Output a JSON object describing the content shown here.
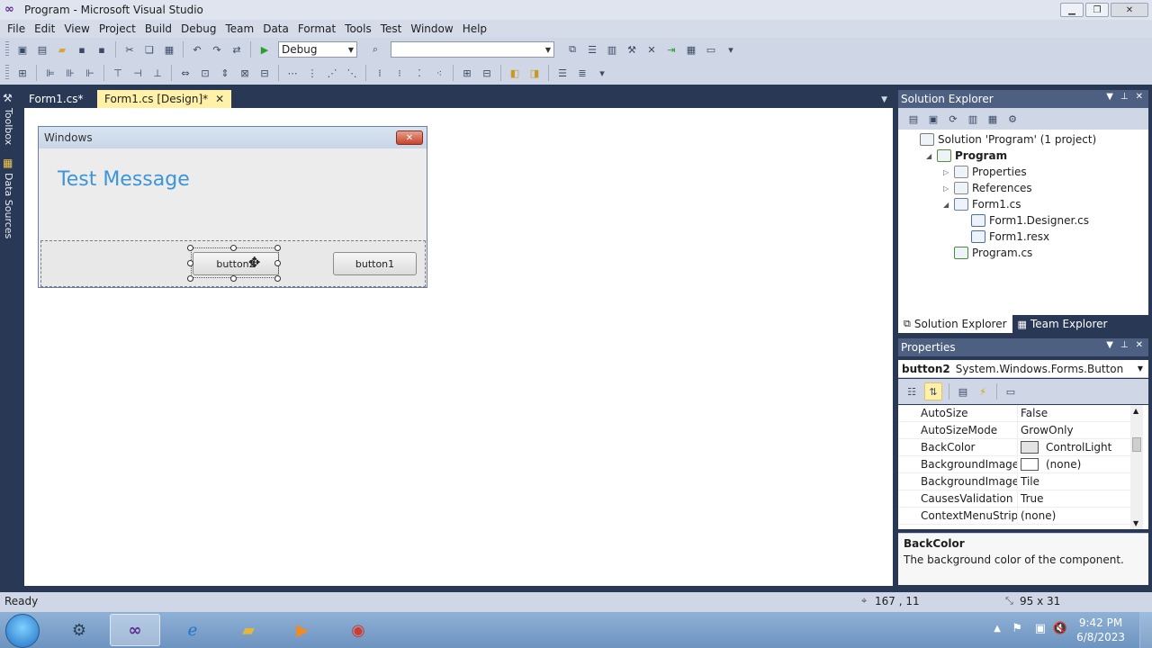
{
  "window": {
    "title": "Program - Microsoft Visual Studio"
  },
  "menu": [
    "File",
    "Edit",
    "View",
    "Project",
    "Build",
    "Debug",
    "Team",
    "Data",
    "Format",
    "Tools",
    "Test",
    "Window",
    "Help"
  ],
  "toolbar": {
    "config": "Debug",
    "platform": ""
  },
  "left_rail": {
    "toolbox": "Toolbox",
    "datasources": "Data Sources"
  },
  "tabs": [
    {
      "label": "Form1.cs*",
      "active": false
    },
    {
      "label": "Form1.cs [Design]*",
      "active": true
    }
  ],
  "designer": {
    "form_title": "Windows",
    "label": "Test Message",
    "button2": "button2",
    "button1": "button1"
  },
  "solution_explorer": {
    "title": "Solution Explorer",
    "tree": [
      {
        "label": "Solution 'Program' (1 project)",
        "level": 0,
        "expander": "",
        "bold": false
      },
      {
        "label": "Program",
        "level": 1,
        "expander": "◢",
        "bold": true
      },
      {
        "label": "Properties",
        "level": 2,
        "expander": "▷",
        "bold": false
      },
      {
        "label": "References",
        "level": 2,
        "expander": "▷",
        "bold": false
      },
      {
        "label": "Form1.cs",
        "level": 2,
        "expander": "◢",
        "bold": false
      },
      {
        "label": "Form1.Designer.cs",
        "level": 3,
        "expander": "",
        "bold": false
      },
      {
        "label": "Form1.resx",
        "level": 3,
        "expander": "",
        "bold": false
      },
      {
        "label": "Program.cs",
        "level": 2,
        "expander": "",
        "bold": false
      }
    ],
    "tabs": [
      "Solution Explorer",
      "Team Explorer"
    ]
  },
  "properties": {
    "title": "Properties",
    "object_name": "button2",
    "object_type": "System.Windows.Forms.Button",
    "rows": [
      {
        "name": "AutoSize",
        "value": "False",
        "swatch": ""
      },
      {
        "name": "AutoSizeMode",
        "value": "GrowOnly",
        "swatch": ""
      },
      {
        "name": "BackColor",
        "value": "ControlLight",
        "swatch": "#e3e3e3"
      },
      {
        "name": "BackgroundImage",
        "value": "(none)",
        "swatch": "#ffffff"
      },
      {
        "name": "BackgroundImageLa",
        "value": "Tile",
        "swatch": ""
      },
      {
        "name": "CausesValidation",
        "value": "True",
        "swatch": ""
      },
      {
        "name": "ContextMenuStrip",
        "value": "(none)",
        "swatch": ""
      }
    ],
    "desc_title": "BackColor",
    "desc_text": "The background color of the component."
  },
  "status": {
    "text": "Ready",
    "position": "167 , 11",
    "size": "95 x 31"
  },
  "taskbar": {
    "time": "9:42 PM",
    "date": "6/8/2023"
  },
  "colors": {
    "accent": "#293955",
    "tab_active": "#fff1a8",
    "label_blue": "#3d95d8"
  }
}
